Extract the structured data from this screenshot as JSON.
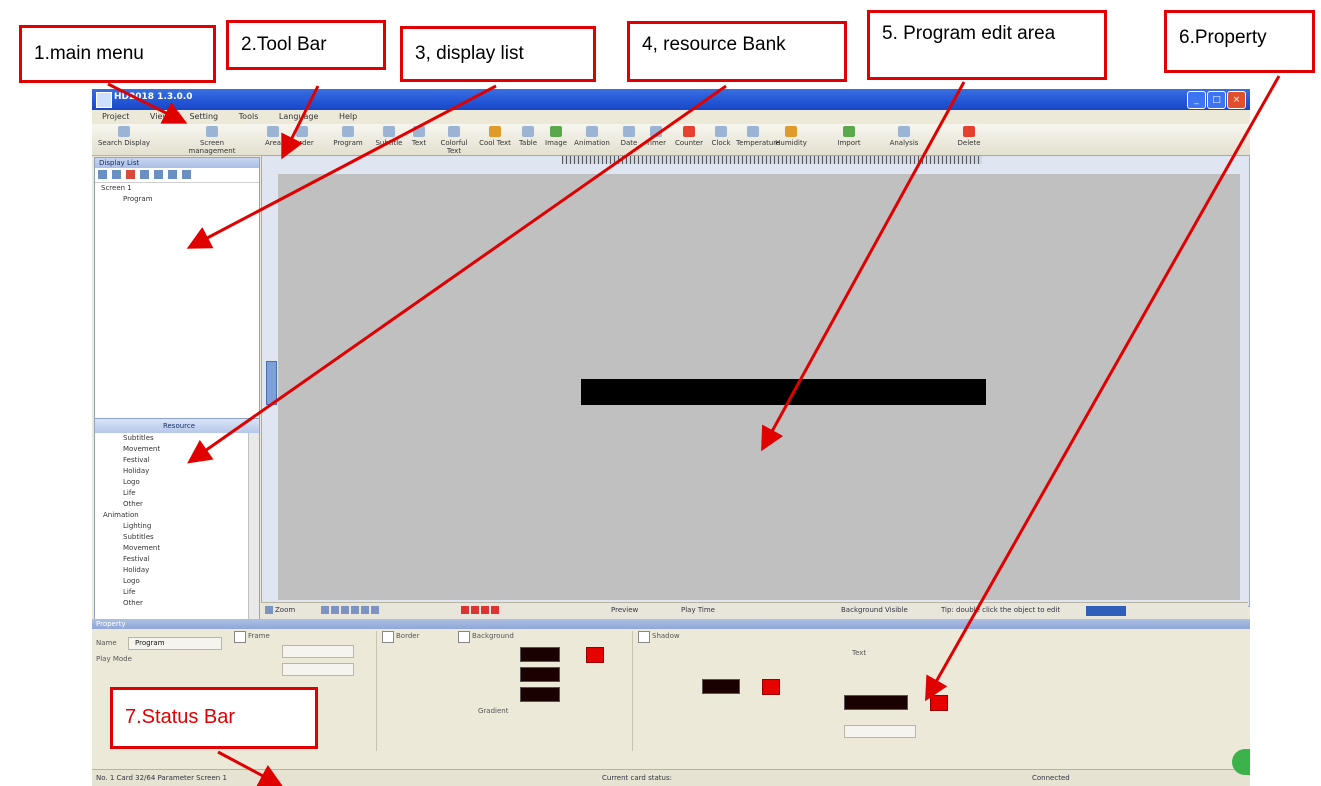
{
  "callouts": {
    "main_menu": "1.main menu",
    "tool_bar": "2.Tool Bar",
    "display_list": "3, display list",
    "resource_bank": "4, resource Bank",
    "program_edit_area": "5. Program edit area",
    "property": "6.Property",
    "status_bar": "7.Status Bar"
  },
  "window": {
    "title": "HD2018 1.3.0.0"
  },
  "menu": [
    "Project",
    "View",
    "Setting",
    "Tools",
    "Language",
    "Help"
  ],
  "toolbar": [
    "Search Display",
    "Screen management",
    "Area",
    "Border",
    "Program",
    "Subtitle",
    "Text",
    "Colorful Text",
    "Cool Text",
    "Table",
    "Image",
    "Animation",
    "Date",
    "Timer",
    "Counter",
    "Clock",
    "Temperature",
    "Humidity",
    "Import",
    "Analysis",
    "Delete"
  ],
  "display_list": {
    "header": "Display List",
    "tree": [
      "Screen 1",
      "Program"
    ]
  },
  "resource_bank": {
    "header": "Resource",
    "items": [
      "Subtitles",
      "Movement",
      "Festival",
      "Holiday",
      "Logo",
      "Life",
      "Other",
      "Animation",
      "Lighting",
      "Subtitles",
      "Movement",
      "Festival",
      "Holiday",
      "Logo",
      "Life",
      "Other"
    ]
  },
  "bottom_toolbar": {
    "zoom": "Zoom",
    "preview": "Preview",
    "play_time": "Play Time",
    "hint": "Tip: double click the object to edit",
    "background_label": "Background Visible"
  },
  "property": {
    "header": "Property",
    "name_label": "Name",
    "name_value": "Program",
    "play_mode": "Play Mode",
    "frame_label": "Frame",
    "background_label": "Background",
    "gradient_label": "Gradient",
    "border_label": "Border",
    "shadow_label": "Shadow",
    "text_label": "Text"
  },
  "status_bar": {
    "left": "No. 1 Card 32/64 Parameter Screen 1",
    "center": "Current card status:",
    "right": "Connected"
  },
  "colors": {
    "callout_border": "#e00000",
    "canvas": "#c0c0c0",
    "accent_red": "#e60000"
  }
}
